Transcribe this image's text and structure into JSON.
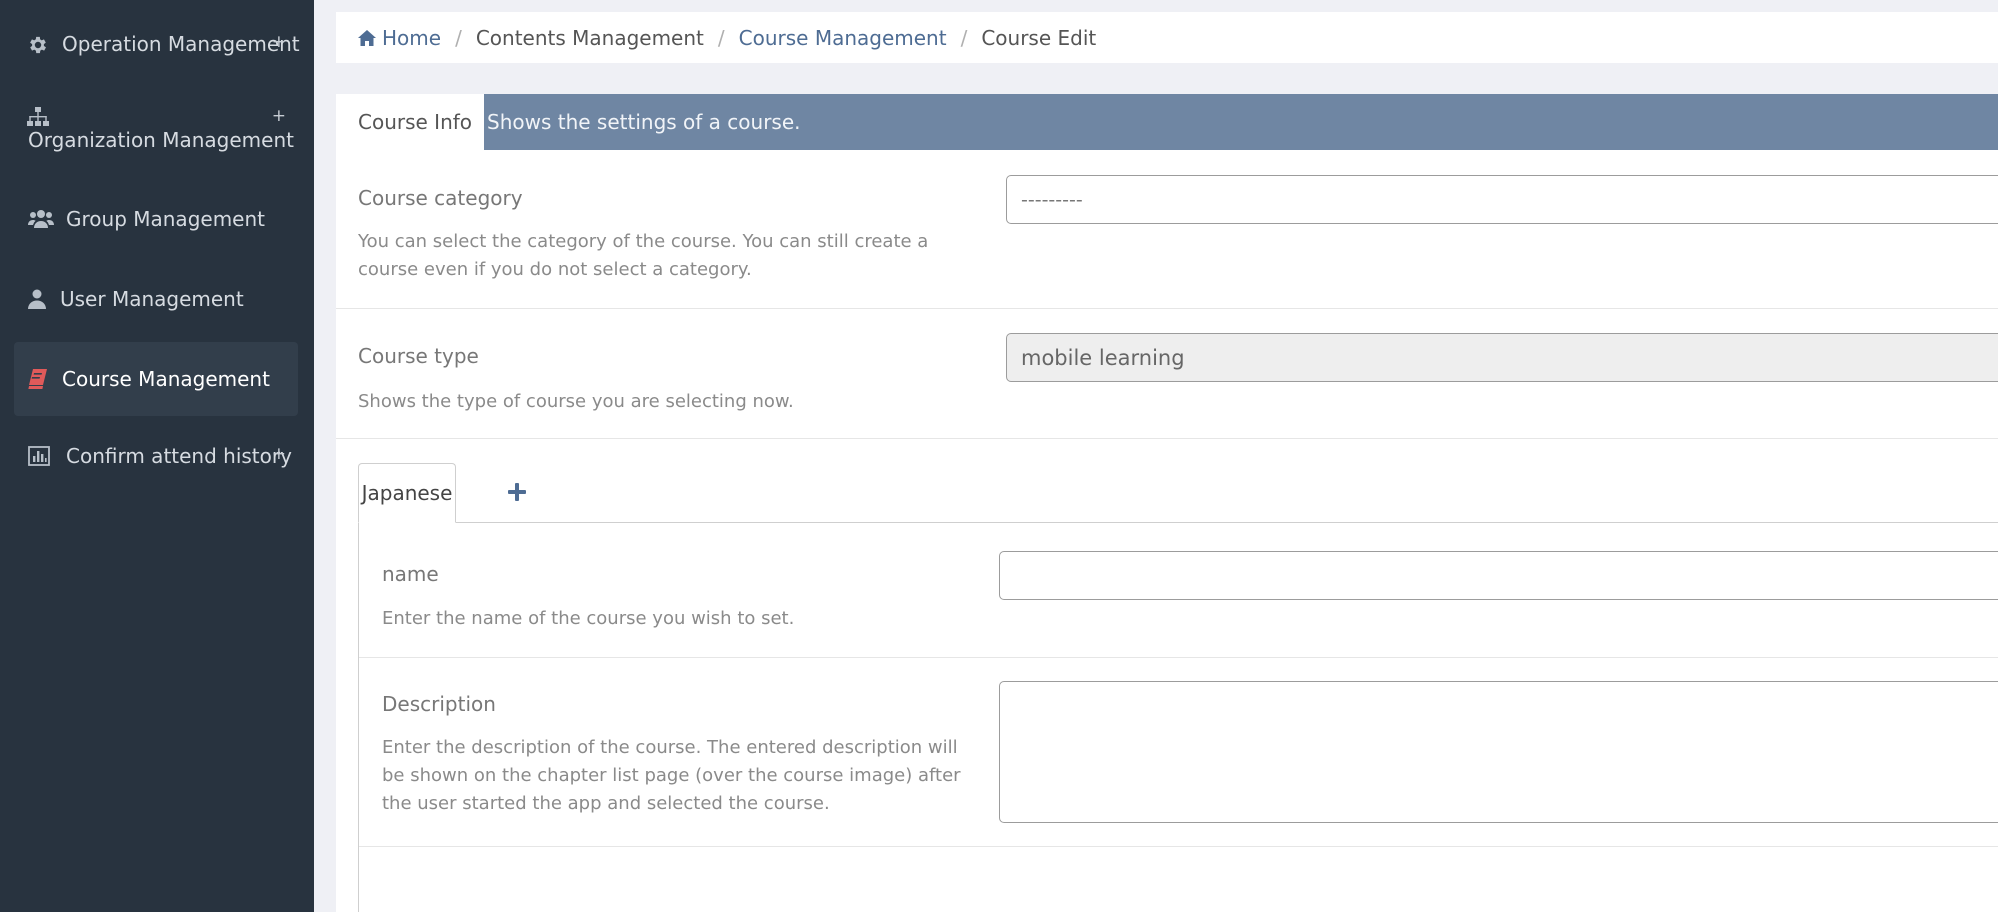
{
  "sidebar": {
    "items": [
      {
        "label": "Operation Management",
        "expand": "+",
        "icon": "gear-icon"
      },
      {
        "label": "Organization Management",
        "expand": "+",
        "icon": "sitemap-icon"
      },
      {
        "label": "Group Management",
        "icon": "users-icon"
      },
      {
        "label": "User Management",
        "icon": "user-icon"
      },
      {
        "label": "Course Management",
        "icon": "book-icon",
        "active": true,
        "accent": "#e05a5a"
      },
      {
        "label": "Confirm attend history",
        "expand": "+",
        "icon": "bar-chart-icon"
      }
    ]
  },
  "breadcrumb": {
    "items": [
      "Home",
      "Contents Management",
      "Course Management",
      "Course Edit"
    ],
    "separator": "/"
  },
  "card": {
    "tab_label": "Course Info",
    "description": "Shows the settings of a course."
  },
  "fields": {
    "course_category": {
      "label": "Course category",
      "help": "You can select the category of the course. You can still create a course even if you do not select a category.",
      "value": "---------"
    },
    "course_type": {
      "label": "Course type",
      "help": "Shows the type of course you are selecting now.",
      "value": "mobile learning"
    }
  },
  "language_tabs": {
    "active": "Japanese",
    "add_label": "+"
  },
  "language_fields": {
    "name": {
      "label": "name",
      "help": "Enter the name of the course you wish to set.",
      "value": ""
    },
    "description": {
      "label": "Description",
      "help": "Enter the description of the course. The entered description will be shown on the chapter list page (over the course image) after the user started the app and selected the course.",
      "value": ""
    }
  },
  "colors": {
    "sidebar_bg": "#28333f",
    "header_bar": "#6f86a3",
    "link": "#4e6c93",
    "active_icon": "#e05a5a"
  }
}
